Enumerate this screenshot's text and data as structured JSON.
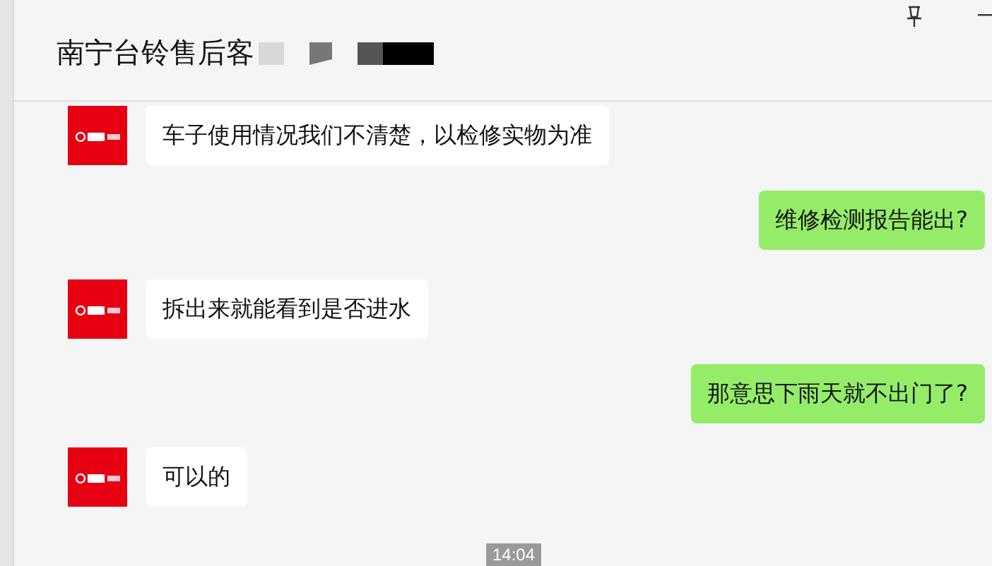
{
  "window": {
    "title": "南宁台铃售后客"
  },
  "messages": [
    {
      "kind": "received",
      "text": "车子使用情况我们不清楚，以检修实物为准"
    },
    {
      "kind": "sent",
      "text": "维修检测报告能出?"
    },
    {
      "kind": "received",
      "text": "拆出来就能看到是否进水"
    },
    {
      "kind": "sent",
      "text": "那意思下雨天就不出门了?"
    },
    {
      "kind": "received",
      "text": "可以的"
    }
  ],
  "timestamp": "14:04"
}
